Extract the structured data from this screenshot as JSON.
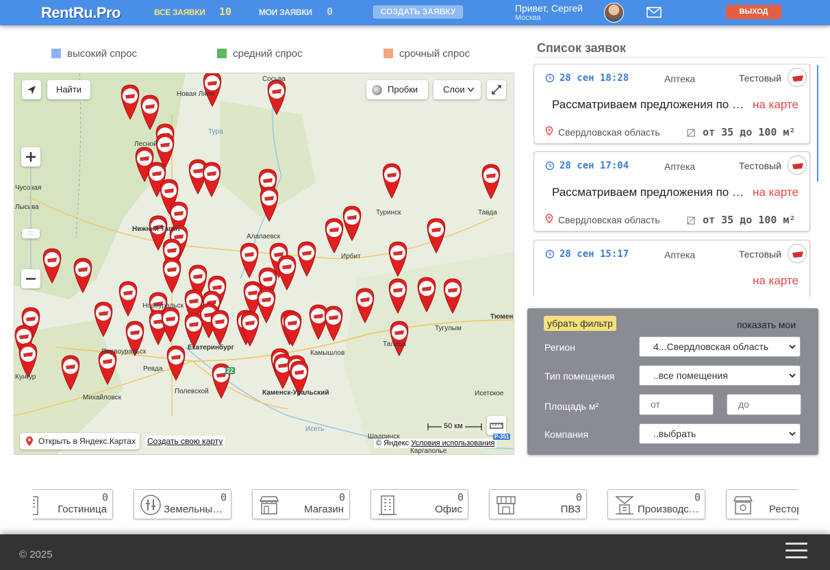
{
  "header": {
    "logo_main": "RentRu",
    "logo_suffix": ".Pro",
    "all_requests_label": "ВСЕ ЗАЯВКИ",
    "all_requests_count": "10",
    "my_requests_label": "МОИ ЗАЯВКИ",
    "my_requests_count": "0",
    "create_label": "СОЗДАТЬ ЗАЯВКУ",
    "greeting": "Привет, Сергей",
    "city": "Москва",
    "logout_label": "ВЫХОД"
  },
  "legend": [
    {
      "label": "высокий спрос",
      "color": "#8fb3f0"
    },
    {
      "label": "средний спрос",
      "color": "#5cb85c"
    },
    {
      "label": "срочный спрос",
      "color": "#f7a57e"
    }
  ],
  "map": {
    "find_label": "Найти",
    "traffic_label": "Пробки",
    "layers_label": "Слои",
    "scale_label": "50 км",
    "open_yandex_label": "Открыть в Яндекс.Картах",
    "create_map_label": "Создать свою карту",
    "copyright": "© Яндекс",
    "terms": "Условия использования",
    "road_badge": "Р-351",
    "road_badge2": "22",
    "cities": [
      "Новая Ляля",
      "Сосьва",
      "Тура",
      "Лесной",
      "Чусовая",
      "Лысьва",
      "Нижний Тагил",
      "Алапаевск",
      "Туринск",
      "Тавда",
      "Ирбит",
      "Новоуральск",
      "Екатеринбург",
      "Первоуральск",
      "Ревда",
      "Полевской",
      "Михайловск",
      "Камышлов",
      "Талица",
      "Тугулым",
      "Тюмень",
      "Каменск-Уральский",
      "Исетское",
      "Исеть",
      "Шадринск",
      "Каргаполье",
      "Кунгур"
    ]
  },
  "request_list": {
    "title": "Список заявок",
    "items": [
      {
        "time": "28 сен 18:28",
        "type": "Аптека",
        "company": "Тестовый",
        "description": "Рассматриваем предложения по аренде",
        "map_link": "на карте",
        "address": "Свердловская область",
        "area": "от 35 до 100 м²"
      },
      {
        "time": "28 сен 17:04",
        "type": "Аптека",
        "company": "Тестовый",
        "description": "Рассматриваем предложения по аренде",
        "map_link": "на карте",
        "address": "Свердловская область",
        "area": "от 35 до 100 м²"
      },
      {
        "time": "28 сен 15:17",
        "type": "Аптека",
        "company": "Тестовый",
        "description": "",
        "map_link": "на карте",
        "address": "",
        "area": ""
      }
    ]
  },
  "filter": {
    "reset_label": "убрать фильтр",
    "show_mine_label": "показать мои",
    "region_label": "Регион",
    "region_value": "4...Свердловская область",
    "premises_label": "Тип помещения",
    "premises_value": "..все помещения",
    "area_label": "Площадь м²",
    "area_from_placeholder": "от",
    "area_to_placeholder": "до",
    "company_label": "Компания",
    "company_value": "..выбрать"
  },
  "categories": [
    {
      "label": "Гостиница",
      "count": "0",
      "icon": "hotel-icon"
    },
    {
      "label": "Земельный участок",
      "count": "0",
      "icon": "land-icon"
    },
    {
      "label": "Магазин",
      "count": "0",
      "icon": "shop-icon"
    },
    {
      "label": "Офис",
      "count": "0",
      "icon": "office-icon"
    },
    {
      "label": "ПВЗ",
      "count": "0",
      "icon": "pickup-point-icon"
    },
    {
      "label": "Производство",
      "count": "0",
      "icon": "factory-icon"
    },
    {
      "label": "Ресторан",
      "count": "",
      "icon": "restaurant-icon"
    }
  ],
  "footer": {
    "copyright": "© 2025"
  },
  "colors": {
    "header_bg": "#4a8fe7",
    "logout_bg": "#e06040",
    "accent_red": "#e64545",
    "filter_bg": "#898c93",
    "footer_bg": "#333333"
  }
}
